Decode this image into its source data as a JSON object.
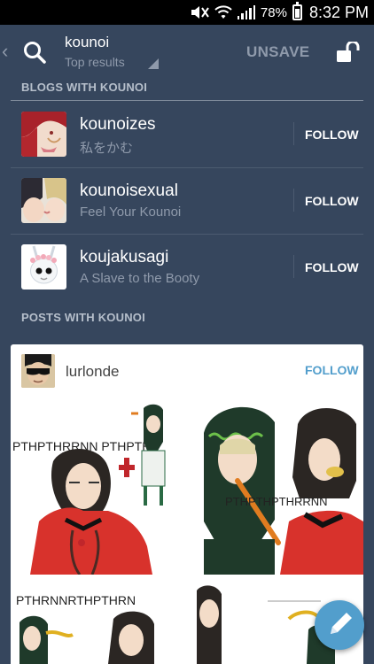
{
  "status_bar": {
    "battery_percent": "78%",
    "time": "8:32 PM"
  },
  "header": {
    "search_term": "kounoi",
    "filter_label": "Top results",
    "unsave_label": "UNSAVE"
  },
  "blogs_section": {
    "label": "BLOGS WITH KOUNOI",
    "items": [
      {
        "name": "kounoizes",
        "subtitle": "私をかむ",
        "follow_label": "FOLLOW"
      },
      {
        "name": "kounoisexual",
        "subtitle": "Feel Your Kounoi",
        "follow_label": "FOLLOW"
      },
      {
        "name": "koujakusagi",
        "subtitle": "A Slave to the Booty",
        "follow_label": "FOLLOW"
      }
    ]
  },
  "posts_section": {
    "label": "POSTS WITH KOUNOI",
    "post": {
      "username": "lurlonde",
      "follow_label": "FOLLOW",
      "images": [
        {
          "caption": "PTHPTHRRNN PTHPTH"
        },
        {
          "caption": "PTHPTHPTHRRNN"
        },
        {
          "caption": "PTHRNNRTHPTHRN"
        },
        {
          "caption": ""
        }
      ]
    }
  },
  "colors": {
    "background": "#36465d",
    "muted_text": "#8f9aab",
    "accent": "#529ecc",
    "card": "#ffffff"
  },
  "icons": [
    "chevron-left-icon",
    "search-icon",
    "dropdown-caret-icon",
    "unlock-icon",
    "pencil-icon"
  ]
}
